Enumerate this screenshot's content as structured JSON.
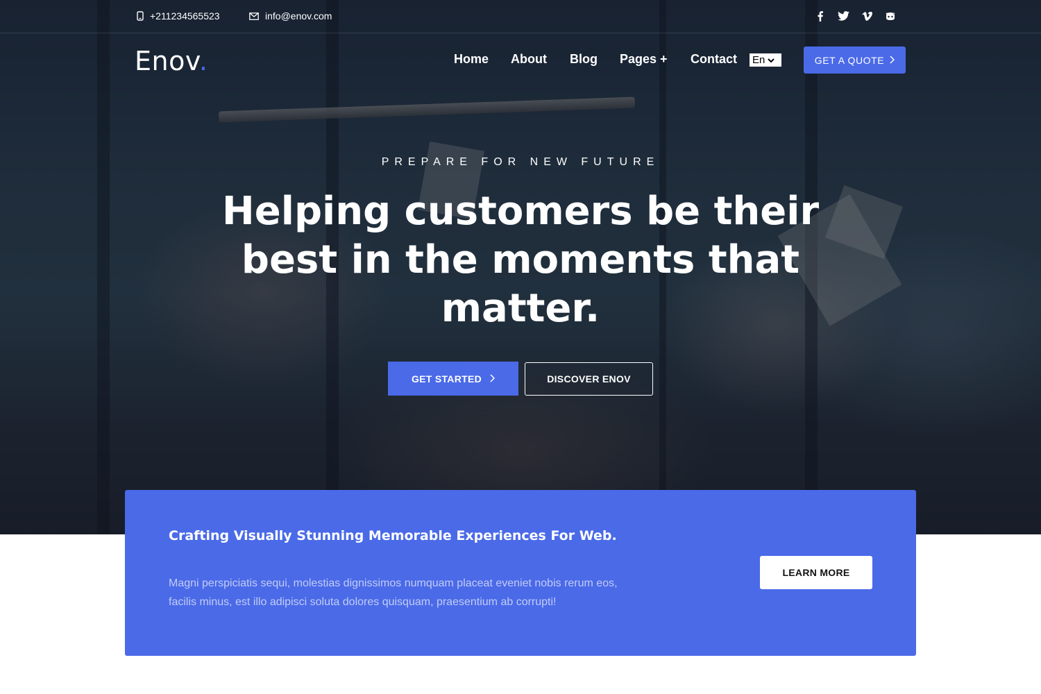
{
  "topbar": {
    "phone": "+211234565523",
    "email": "info@enov.com",
    "social": [
      "facebook-icon",
      "twitter-icon",
      "vimeo-icon",
      "github-icon"
    ]
  },
  "header": {
    "logo_text": "Enov",
    "logo_dot": ".",
    "nav": [
      "Home",
      "About",
      "Blog",
      "Pages +",
      "Contact"
    ],
    "language": "En",
    "quote_button": "GET A QUOTE"
  },
  "hero": {
    "eyebrow": "PREPARE FOR NEW FUTURE",
    "headline": "Helping customers be their best in the moments that matter.",
    "primary_button": "GET STARTED",
    "secondary_button": "DISCOVER ENOV"
  },
  "promo": {
    "title": "Crafting Visually Stunning Memorable Experiences For Web.",
    "text": "Magni perspiciatis sequi, molestias dignissimos numquam placeat eveniet nobis rerum eos, facilis minus, est illo adipisci soluta dolores quisquam, praesentium ab corrupti!",
    "button": "LEARN MORE"
  },
  "colors": {
    "accent": "#4a6ae8",
    "promo_text": "#c3ccf6"
  }
}
